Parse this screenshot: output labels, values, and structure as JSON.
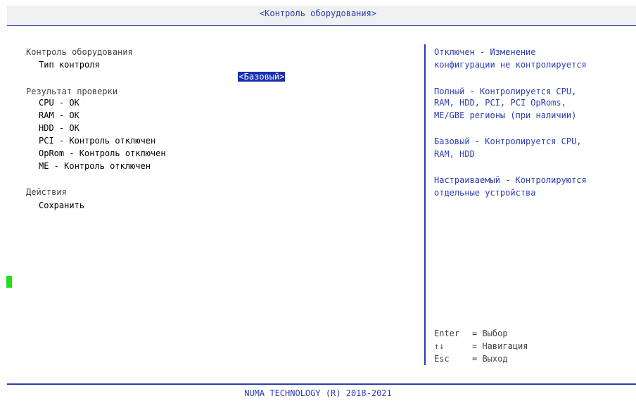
{
  "header": {
    "title": "<Контроль оборудования>"
  },
  "footer": {
    "copyright": "NUMA TECHNOLOGY (R) 2018-2021"
  },
  "left_panel": {
    "section_control": {
      "heading": "Контроль оборудования",
      "control_type_label": "Тип контроля",
      "control_type_value": "<Базовый>"
    },
    "section_result": {
      "heading": "Результат проверки",
      "items": [
        "CPU - OK",
        "RAM - OK",
        "HDD - OK",
        "PCI - Контроль отключен",
        "OpRom - Контроль отключен",
        "ME - Контроль отключен"
      ]
    },
    "section_actions": {
      "heading": "Действия",
      "save_label": "Сохранить"
    }
  },
  "help_panel": {
    "lines": [
      "Отключен - Изменение",
      "конфигурации не контролируется",
      "Полный - Контролируется CPU,",
      "RAM, HDD, PCI, PCI OpRoms,",
      "ME/GBE регионы (при наличии)",
      "Базовый - Контролируется CPU,",
      "RAM, HDD",
      "Настраиваемый - Контролируются",
      "отдельные устройства"
    ],
    "keys": [
      {
        "key": "Enter",
        "action": "= Выбор"
      },
      {
        "key": "↑↓",
        "action": "= Навигация"
      },
      {
        "key": "Esc",
        "action": "= Выход"
      }
    ]
  },
  "colors": {
    "accent": "#2a3db4",
    "selection_bg": "#1a2fb0",
    "cursor": "#1ee01e",
    "header_bg": "#f0f0f0"
  }
}
